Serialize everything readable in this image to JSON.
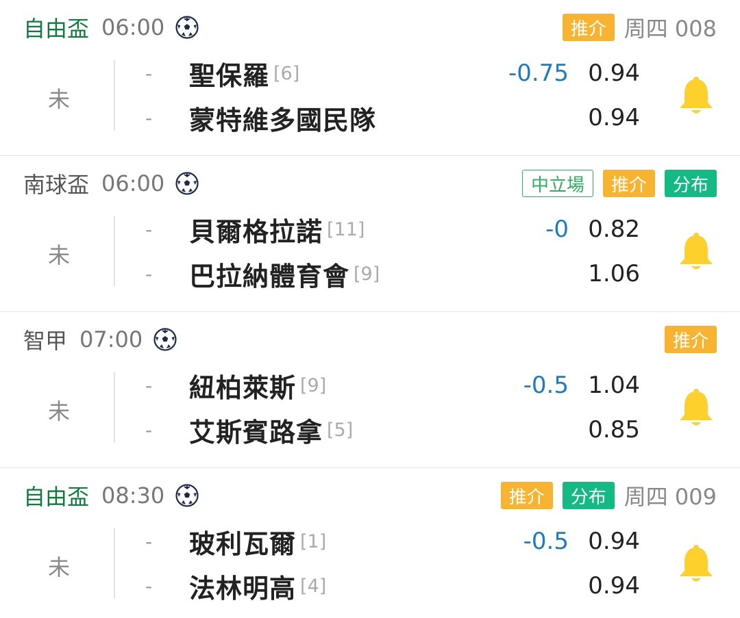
{
  "status_label": "未",
  "dash": "-",
  "colors": {
    "league_green": "#0e7a3c",
    "orange_badge": "#f8b431",
    "teal_badge": "#15b983",
    "handicap_blue": "#1e7bbf",
    "bell_yellow": "#fdd02c"
  },
  "matches": [
    {
      "league": "自由盃",
      "league_color": "green",
      "time": "06:00",
      "badges": [
        {
          "label": "推介",
          "style": "orange"
        }
      ],
      "match_no": "周四 008",
      "home": {
        "name": "聖保羅",
        "rank": "[6]",
        "odds": "0.94"
      },
      "away": {
        "name": "蒙特維多國民隊",
        "rank": "",
        "odds": "0.94"
      },
      "handicap": "-0.75"
    },
    {
      "league": "南球盃",
      "league_color": "gray",
      "time": "06:00",
      "badges": [
        {
          "label": "中立場",
          "style": "outline"
        },
        {
          "label": "推介",
          "style": "orange"
        },
        {
          "label": "分布",
          "style": "teal"
        }
      ],
      "match_no": "",
      "home": {
        "name": "貝爾格拉諾",
        "rank": "[11]",
        "odds": "0.82"
      },
      "away": {
        "name": "巴拉納體育會",
        "rank": "[9]",
        "odds": "1.06"
      },
      "handicap": "-0"
    },
    {
      "league": "智甲",
      "league_color": "gray",
      "time": "07:00",
      "badges": [
        {
          "label": "推介",
          "style": "orange"
        }
      ],
      "match_no": "",
      "home": {
        "name": "紐柏萊斯",
        "rank": "[9]",
        "odds": "1.04"
      },
      "away": {
        "name": "艾斯賓路拿",
        "rank": "[5]",
        "odds": "0.85"
      },
      "handicap": "-0.5"
    },
    {
      "league": "自由盃",
      "league_color": "green",
      "time": "08:30",
      "badges": [
        {
          "label": "推介",
          "style": "orange"
        },
        {
          "label": "分布",
          "style": "teal"
        }
      ],
      "match_no": "周四 009",
      "home": {
        "name": "玻利瓦爾",
        "rank": "[1]",
        "odds": "0.94"
      },
      "away": {
        "name": "法林明高",
        "rank": "[4]",
        "odds": "0.94"
      },
      "handicap": "-0.5"
    }
  ]
}
